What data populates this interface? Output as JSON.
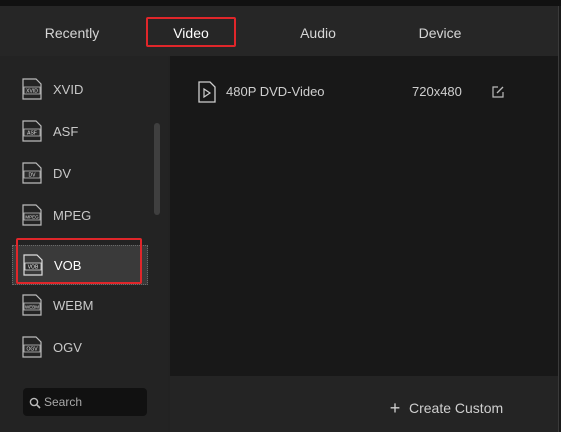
{
  "tabs": [
    {
      "label": "Recently"
    },
    {
      "label": "Video"
    },
    {
      "label": "Audio"
    },
    {
      "label": "Device"
    }
  ],
  "active_tab": "Video",
  "formats": [
    {
      "label": "XVID",
      "icon_text": "XVID"
    },
    {
      "label": "ASF",
      "icon_text": "ASF"
    },
    {
      "label": "DV",
      "icon_text": "DV"
    },
    {
      "label": "MPEG",
      "icon_text": "MPEG"
    },
    {
      "label": "VOB",
      "icon_text": "VOB"
    },
    {
      "label": "WEBM",
      "icon_text": "WEBM"
    },
    {
      "label": "OGV",
      "icon_text": "OGV"
    }
  ],
  "selected_format": "VOB",
  "search": {
    "placeholder": "Search"
  },
  "presets": [
    {
      "name": "480P DVD-Video",
      "resolution": "720x480"
    }
  ],
  "footer": {
    "create_label": "Create Custom",
    "create_icon": "+"
  },
  "colors": {
    "highlight": "#e0262a",
    "background": "#222222"
  }
}
